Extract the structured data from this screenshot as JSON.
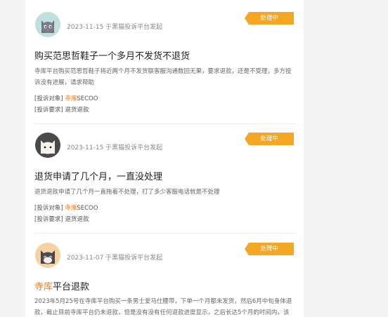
{
  "complaints": [
    {
      "meta": "2023-11-15 于黑猫投诉平台发起",
      "status": "处理中",
      "title": "购买范思哲鞋子一个多月不发货不退货",
      "desc": "寺库平台购买范思哲鞋子将近两个月不发货联客服沟通数回无果，要求退款，还是不受理，多方投诉没有进展，请求帮助",
      "target_label": "[投诉对象]",
      "target_link": "寺库",
      "target_rest": "SECOO",
      "request_label": "[投诉要求]",
      "request_value": "退货退款"
    },
    {
      "meta": "2023-11-15 于黑猫投诉平台发起",
      "status": "处理中",
      "title": "退货申请了几个月，一直没处理",
      "desc": "退货退款申请了几个月一直拖着不处理，打了多少客服电话就是不处理",
      "target_label": "[投诉对象]",
      "target_link": "寺库",
      "target_rest": "SECOO",
      "request_label": "[投诉要求]",
      "request_value": "退货退款"
    },
    {
      "meta": "2023-11-07 于黑猫投诉平台发起",
      "status": "处理中",
      "title_hl": "寺库",
      "title_rest": "平台退款",
      "desc": "2023年5月25号在寺库平台购买一条男士爱马仕腰带，下单一个月都未发货，然后6月中旬身体退款，截止目前寺库平台仍未退款，但是没有没有任何退款进度显示，之后长达5个月的时间内，该"
    }
  ]
}
